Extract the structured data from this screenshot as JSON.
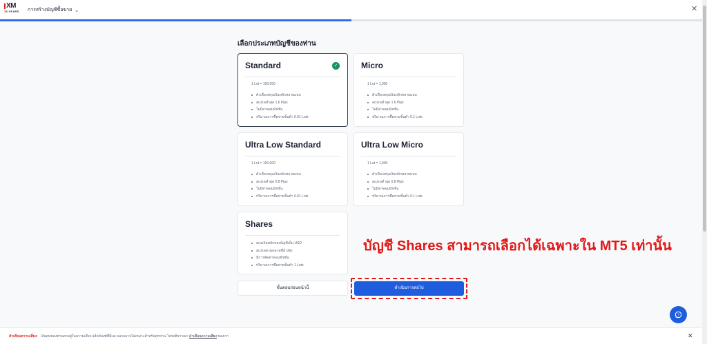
{
  "header": {
    "logo_text": "XM",
    "logo_subtext": "15 YEARS",
    "title": "การสร้างบัญชีซื้อขาย",
    "close_glyph": "✕"
  },
  "progress": {
    "value_percent": 50,
    "color": "#2b6cf0"
  },
  "page": {
    "section_title": "เลือกประเภทบัญชีของท่าน",
    "selected_account": "Standard"
  },
  "cards": [
    {
      "name": "Standard",
      "lot": "1 Lot = 100,000",
      "features": [
        "ตัวเลือกสกุลเงินหลักหลายแบบ",
        "สเปรดต่ำสุด 1.6 Pips",
        "ไม่มีค่าคอมมิชชั่น",
        "ปริมาณการซื้อขายขั้นต่ำ 0.01 Lots"
      ],
      "selected": true
    },
    {
      "name": "Micro",
      "lot": "1 Lot = 1,000",
      "features": [
        "ตัวเลือกสกุลเงินหลักหลายแบบ",
        "สเปรดต่ำสุด 1.6 Pips",
        "ไม่มีค่าคอมมิชชั่น",
        "ปริมาณการซื้อขายขั้นต่ำ 0.1 Lots"
      ],
      "selected": false
    },
    {
      "name": "Ultra Low Standard",
      "lot": "1 Lot = 100,000",
      "features": [
        "ตัวเลือกสกุลเงินหลักหลายแบบ",
        "สเปรดต่ำสุด 0.8 Pips",
        "ไม่มีค่าคอมมิชชั่น",
        "ปริมาณการซื้อขายขั้นต่ำ 0.01 Lots"
      ],
      "selected": false
    },
    {
      "name": "Ultra Low Micro",
      "lot": "1 Lot = 1,000",
      "features": [
        "ตัวเลือกสกุลเงินหลักหลายแบบ",
        "สเปรดต่ำสุด 0.8 Pips",
        "ไม่มีค่าคอมมิชชั่น",
        "ปริมาณการซื้อขายขั้นต่ำ 0.1 Lots"
      ],
      "selected": false
    },
    {
      "name": "Shares",
      "features": [
        "สกุลเงินหลักของบัญชีเป็น USD",
        "สเปรดตามตลาดที่อ้างอิง",
        "มีการคิดค่าคอมมิชชั่น",
        "ปริมาณการซื้อขายขั้นต่ำ 1 Lots"
      ],
      "selected": false
    }
  ],
  "buttons": {
    "back_label": "ขั้นตอนก่อนหน้านี้",
    "next_label": "ดำเนินการต่อไป"
  },
  "annotation": "บัญชี Shares สามารถเลือกได้เฉพาะใน MT5 เท่านั้น",
  "risk_banner": {
    "label": "คำเตือนความเสี่ยง:",
    "text": "เงินทุนของท่านตกอยู่ในความเสี่ยง ผลิตภัณฑ์ที่มีเลเวอเรจอาจไม่เหมาะสำหรับทุกท่าน โปรดพิจารณา",
    "link": "คำเตือนความเสี่ยง",
    "suffix": "ของเรา"
  },
  "colors": {
    "accent": "#1f5ddf",
    "selected_check": "#14935e",
    "annotation": "#e01818",
    "warning": "#d43030"
  },
  "icons": {
    "check": "check-icon",
    "chevron": "chevron-down-icon",
    "close": "close-icon",
    "help": "chat-help-icon"
  }
}
